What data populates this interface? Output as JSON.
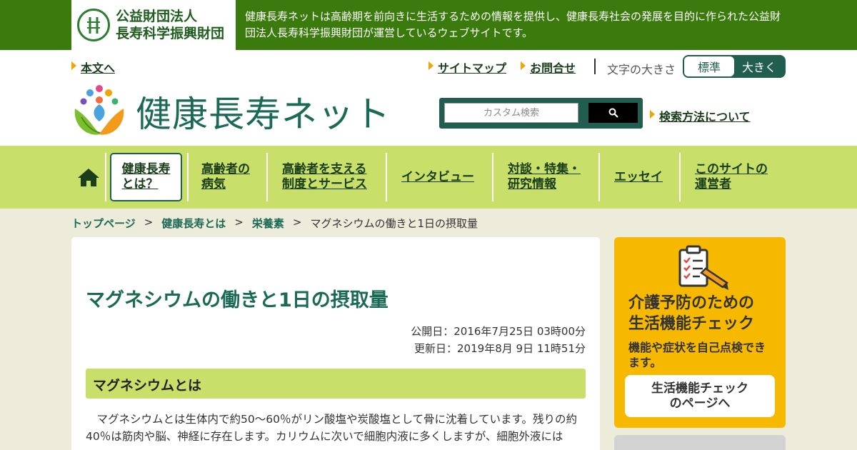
{
  "topbar": {
    "org_line1": "公益財団法人",
    "org_line2": "長寿科学振興財団",
    "description": "健康長寿ネットは高齢期を前向きに生活するための情報を提供し、健康長寿社会の発展を目的に作られた公益財団法人長寿科学振興財団が運営しているウェブサイトです。"
  },
  "header": {
    "skip_label": "本文へ",
    "sitemap_label": "サイトマップ",
    "contact_label": "お問合せ",
    "fontsize_label": "文字の大きさ",
    "fontsize_standard": "標準",
    "fontsize_large": "大きく",
    "site_title": "健康長寿ネット",
    "search_placeholder": "カスタム検索",
    "search_help": "検索方法について"
  },
  "nav": {
    "items": [
      {
        "line1": "健康長寿",
        "line2": "とは？"
      },
      {
        "line1": "高齢者の",
        "line2": "病気"
      },
      {
        "line1": "高齢者を支える",
        "line2": "制度とサービス"
      },
      {
        "line1": "インタビュー",
        "line2": ""
      },
      {
        "line1": "対談・特集・",
        "line2": "研究情報"
      },
      {
        "line1": "エッセイ",
        "line2": ""
      },
      {
        "line1": "このサイトの",
        "line2": "運営者"
      }
    ]
  },
  "breadcrumb": {
    "items": [
      "トップページ",
      "健康長寿とは",
      "栄養素"
    ],
    "current": "マグネシウムの働きと1日の摂取量",
    "separator": ">"
  },
  "article": {
    "title": "マグネシウムの働きと1日の摂取量",
    "published": "公開日：2016年7月25日 03時00分",
    "updated": "更新日：2019年8月 9日 11時51分",
    "section_heading": "マグネシウムとは",
    "body": "マグネシウムとは生体内で約50～60％がリン酸塩や炭酸塩として骨に沈着しています。残りの約40％は筋肉や脳、神経に存在します。カリウムに次いで細胞内液に多くしますが、細胞外液には"
  },
  "sidebar": {
    "title_line1": "介護予防のための",
    "title_line2": "生活機能チェック",
    "description": "機能や症状を自己点検できます。",
    "button_line1": "生活機能チェック",
    "button_line2": "のページへ"
  },
  "colors": {
    "brand_green": "#3b7a0c",
    "teal": "#225e50",
    "nav_green": "#c8e06a",
    "accent_yellow": "#f7b800"
  }
}
